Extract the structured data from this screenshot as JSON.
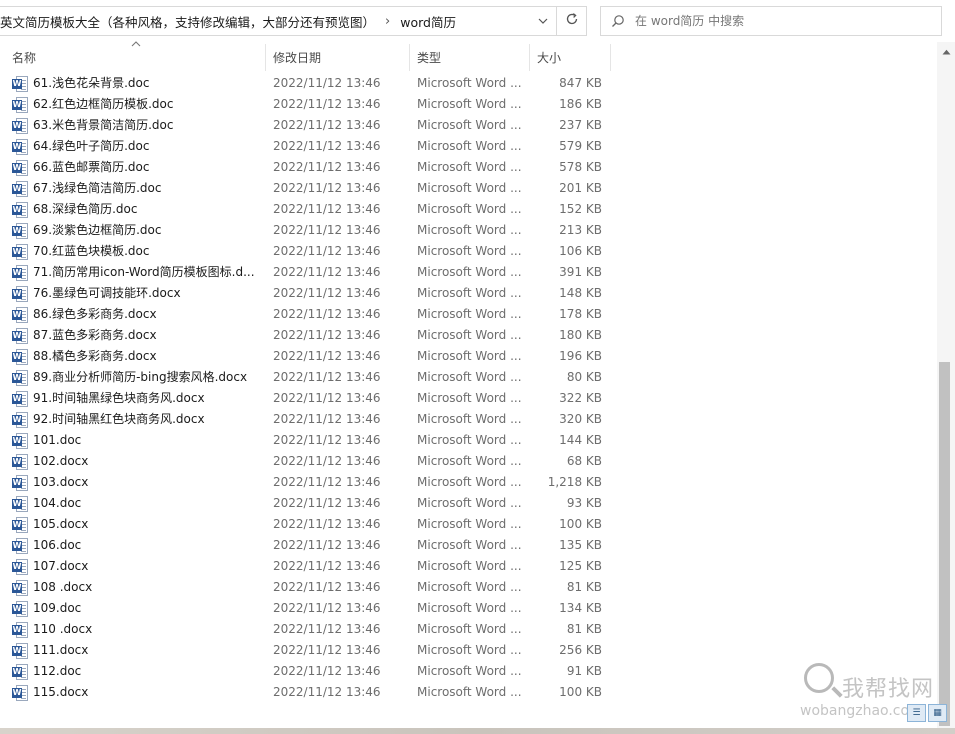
{
  "address": {
    "root": "英文简历模板大全（各种风格，支持修改编辑，大部分还有预览图）",
    "separator": "›",
    "current": "word简历",
    "dropdown_icon": "chevron-down-icon",
    "refresh_icon": "refresh-icon"
  },
  "search": {
    "placeholder": "在 word简历 中搜索",
    "icon": "search-icon"
  },
  "columns": {
    "name": "名称",
    "date": "修改日期",
    "type": "类型",
    "size": "大小"
  },
  "files": [
    {
      "name": "61.浅色花朵背景.doc",
      "date": "2022/11/12 13:46",
      "type": "Microsoft Word ...",
      "size": "847 KB"
    },
    {
      "name": "62.红色边框简历模板.doc",
      "date": "2022/11/12 13:46",
      "type": "Microsoft Word ...",
      "size": "186 KB"
    },
    {
      "name": "63.米色背景简洁简历.doc",
      "date": "2022/11/12 13:46",
      "type": "Microsoft Word ...",
      "size": "237 KB"
    },
    {
      "name": "64.绿色叶子简历.doc",
      "date": "2022/11/12 13:46",
      "type": "Microsoft Word ...",
      "size": "579 KB"
    },
    {
      "name": "66.蓝色邮票简历.doc",
      "date": "2022/11/12 13:46",
      "type": "Microsoft Word ...",
      "size": "578 KB"
    },
    {
      "name": "67.浅绿色简洁简历.doc",
      "date": "2022/11/12 13:46",
      "type": "Microsoft Word ...",
      "size": "201 KB"
    },
    {
      "name": "68.深绿色简历.doc",
      "date": "2022/11/12 13:46",
      "type": "Microsoft Word ...",
      "size": "152 KB"
    },
    {
      "name": "69.淡紫色边框简历.doc",
      "date": "2022/11/12 13:46",
      "type": "Microsoft Word ...",
      "size": "213 KB"
    },
    {
      "name": "70.红蓝色块模板.doc",
      "date": "2022/11/12 13:46",
      "type": "Microsoft Word ...",
      "size": "106 KB"
    },
    {
      "name": "71.简历常用icon-Word简历模板图标.d...",
      "date": "2022/11/12 13:46",
      "type": "Microsoft Word ...",
      "size": "391 KB"
    },
    {
      "name": "76.墨绿色可调技能环.docx",
      "date": "2022/11/12 13:46",
      "type": "Microsoft Word ...",
      "size": "148 KB"
    },
    {
      "name": "86.绿色多彩商务.docx",
      "date": "2022/11/12 13:46",
      "type": "Microsoft Word ...",
      "size": "178 KB"
    },
    {
      "name": "87.蓝色多彩商务.docx",
      "date": "2022/11/12 13:46",
      "type": "Microsoft Word ...",
      "size": "180 KB"
    },
    {
      "name": "88.橘色多彩商务.docx",
      "date": "2022/11/12 13:46",
      "type": "Microsoft Word ...",
      "size": "196 KB"
    },
    {
      "name": "89.商业分析师简历-bing搜索风格.docx",
      "date": "2022/11/12 13:46",
      "type": "Microsoft Word ...",
      "size": "80 KB"
    },
    {
      "name": "91.时间轴黑绿色块商务风.docx",
      "date": "2022/11/12 13:46",
      "type": "Microsoft Word ...",
      "size": "322 KB"
    },
    {
      "name": "92.时间轴黑红色块商务风.docx",
      "date": "2022/11/12 13:46",
      "type": "Microsoft Word ...",
      "size": "320 KB"
    },
    {
      "name": "101.doc",
      "date": "2022/11/12 13:46",
      "type": "Microsoft Word ...",
      "size": "144 KB"
    },
    {
      "name": "102.docx",
      "date": "2022/11/12 13:46",
      "type": "Microsoft Word ...",
      "size": "68 KB"
    },
    {
      "name": "103.docx",
      "date": "2022/11/12 13:46",
      "type": "Microsoft Word ...",
      "size": "1,218 KB"
    },
    {
      "name": "104.doc",
      "date": "2022/11/12 13:46",
      "type": "Microsoft Word ...",
      "size": "93 KB"
    },
    {
      "name": "105.docx",
      "date": "2022/11/12 13:46",
      "type": "Microsoft Word ...",
      "size": "100 KB"
    },
    {
      "name": "106.doc",
      "date": "2022/11/12 13:46",
      "type": "Microsoft Word ...",
      "size": "135 KB"
    },
    {
      "name": "107.docx",
      "date": "2022/11/12 13:46",
      "type": "Microsoft Word ...",
      "size": "125 KB"
    },
    {
      "name": "108 .docx",
      "date": "2022/11/12 13:46",
      "type": "Microsoft Word ...",
      "size": "81 KB"
    },
    {
      "name": "109.doc",
      "date": "2022/11/12 13:46",
      "type": "Microsoft Word ...",
      "size": "134 KB"
    },
    {
      "name": "110 .docx",
      "date": "2022/11/12 13:46",
      "type": "Microsoft Word ...",
      "size": "81 KB"
    },
    {
      "name": "111.docx",
      "date": "2022/11/12 13:46",
      "type": "Microsoft Word ...",
      "size": "256 KB"
    },
    {
      "name": "112.doc",
      "date": "2022/11/12 13:46",
      "type": "Microsoft Word ...",
      "size": "91 KB"
    },
    {
      "name": "115.docx",
      "date": "2022/11/12 13:46",
      "type": "Microsoft Word ...",
      "size": "100 KB"
    }
  ],
  "file_icon": "word-document-icon",
  "file_icon_badge": "W",
  "watermark": {
    "cn": "我帮找网",
    "en": "wobangzhao.com"
  },
  "colors": {
    "word_blue": "#2b5797",
    "scroll_thumb": "#c1c1c1"
  }
}
